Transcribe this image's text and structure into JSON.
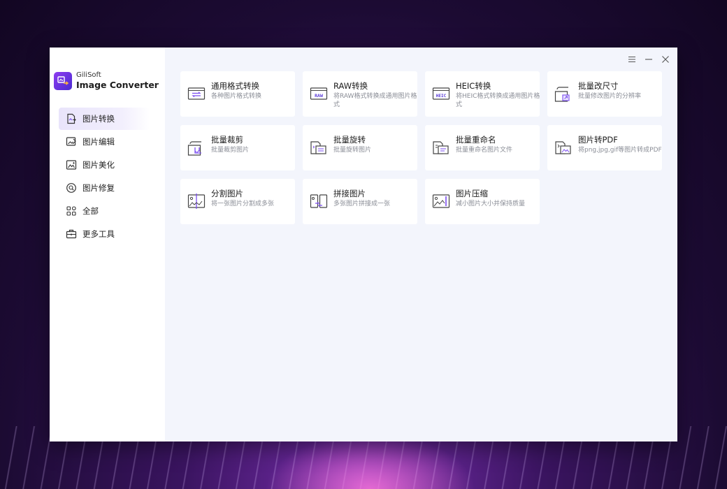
{
  "brand": {
    "sub": "GiliSoft",
    "main": "Image Converter"
  },
  "nav": [
    {
      "label": "图片转换",
      "icon": "image-convert-icon",
      "active": true
    },
    {
      "label": "图片编辑",
      "icon": "image-edit-icon"
    },
    {
      "label": "图片美化",
      "icon": "image-beautify-icon"
    },
    {
      "label": "图片修复",
      "icon": "image-repair-icon"
    },
    {
      "label": "全部",
      "icon": "all-grid-icon"
    },
    {
      "label": "更多工具",
      "icon": "toolbox-icon"
    }
  ],
  "window_controls": {
    "menu": "☰",
    "minimize": "—",
    "close": "✕"
  },
  "cards": [
    {
      "title": "通用格式转换",
      "desc": "各种图片格式转换",
      "icon": "format-convert-icon"
    },
    {
      "title": "RAW转换",
      "desc": "将RAW格式转换成通用图片格式",
      "icon": "raw-icon",
      "badge": "RAW"
    },
    {
      "title": "HEIC转换",
      "desc": "将HEIC格式转换成通用图片格式",
      "icon": "heic-icon",
      "badge": "HEIC"
    },
    {
      "title": "批量改尺寸",
      "desc": "批量修改图片的分辨率",
      "icon": "resize-icon"
    },
    {
      "title": "批量裁剪",
      "desc": "批量裁剪图片",
      "icon": "crop-icon"
    },
    {
      "title": "批量旋转",
      "desc": "批量旋转图片",
      "icon": "rotate-icon"
    },
    {
      "title": "批量重命名",
      "desc": "批量重命名图片文件",
      "icon": "rename-icon"
    },
    {
      "title": "图片转PDF",
      "desc": "将png,jpg,gif等图片转成PDF",
      "icon": "image-to-pdf-icon"
    },
    {
      "title": "分割图片",
      "desc": "将一张图片分割成多张",
      "icon": "split-icon"
    },
    {
      "title": "拼接图片",
      "desc": "多张图片拼接成一张",
      "icon": "merge-icon"
    },
    {
      "title": "图片压缩",
      "desc": "减小图片大小并保持质量",
      "icon": "compress-icon"
    }
  ],
  "colors": {
    "accent": "#7b4df0",
    "brand_gradient_start": "#8e3cf0",
    "brand_gradient_end": "#4a2bd1",
    "active_nav": "#e9e4fb"
  }
}
